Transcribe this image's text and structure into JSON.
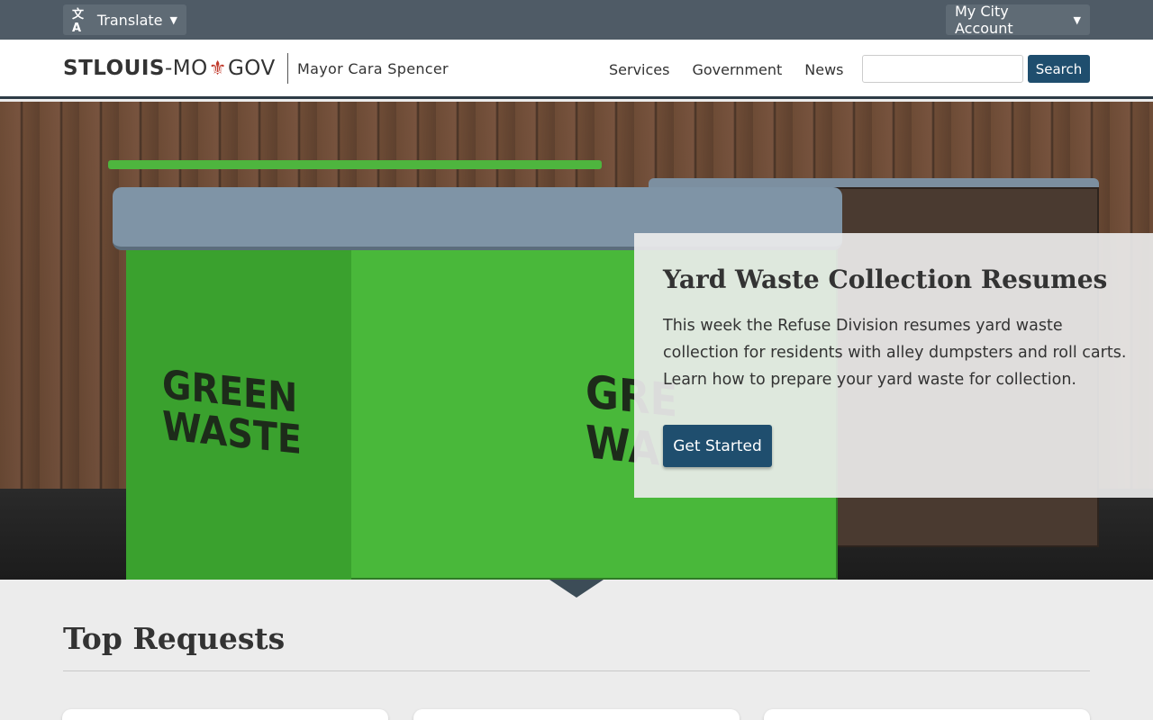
{
  "topbar": {
    "translate_label": "Translate",
    "account_label": "My City Account"
  },
  "header": {
    "logo_bold": "STLOUIS",
    "logo_mid": "-MO",
    "logo_end": "GOV",
    "mayor": "Mayor Cara Spencer",
    "nav": [
      "Services",
      "Government",
      "News"
    ],
    "search_label": "Search",
    "search_value": ""
  },
  "hero": {
    "image_text_left": [
      "GREEN",
      "WASTE"
    ],
    "image_text_right": [
      "GRE",
      "WAS"
    ],
    "title": "Yard Waste Collection Resumes",
    "body": "This week the Refuse Division resumes yard waste collection for residents with alley dumpsters and roll carts. Learn how to prepare your yard waste for collection.",
    "cta": "Get Started"
  },
  "top_requests": {
    "title": "Top Requests"
  },
  "colors": {
    "topbar": "#4f5b66",
    "primary": "#1f4e6e",
    "logo_fleur": "#c0392b"
  }
}
